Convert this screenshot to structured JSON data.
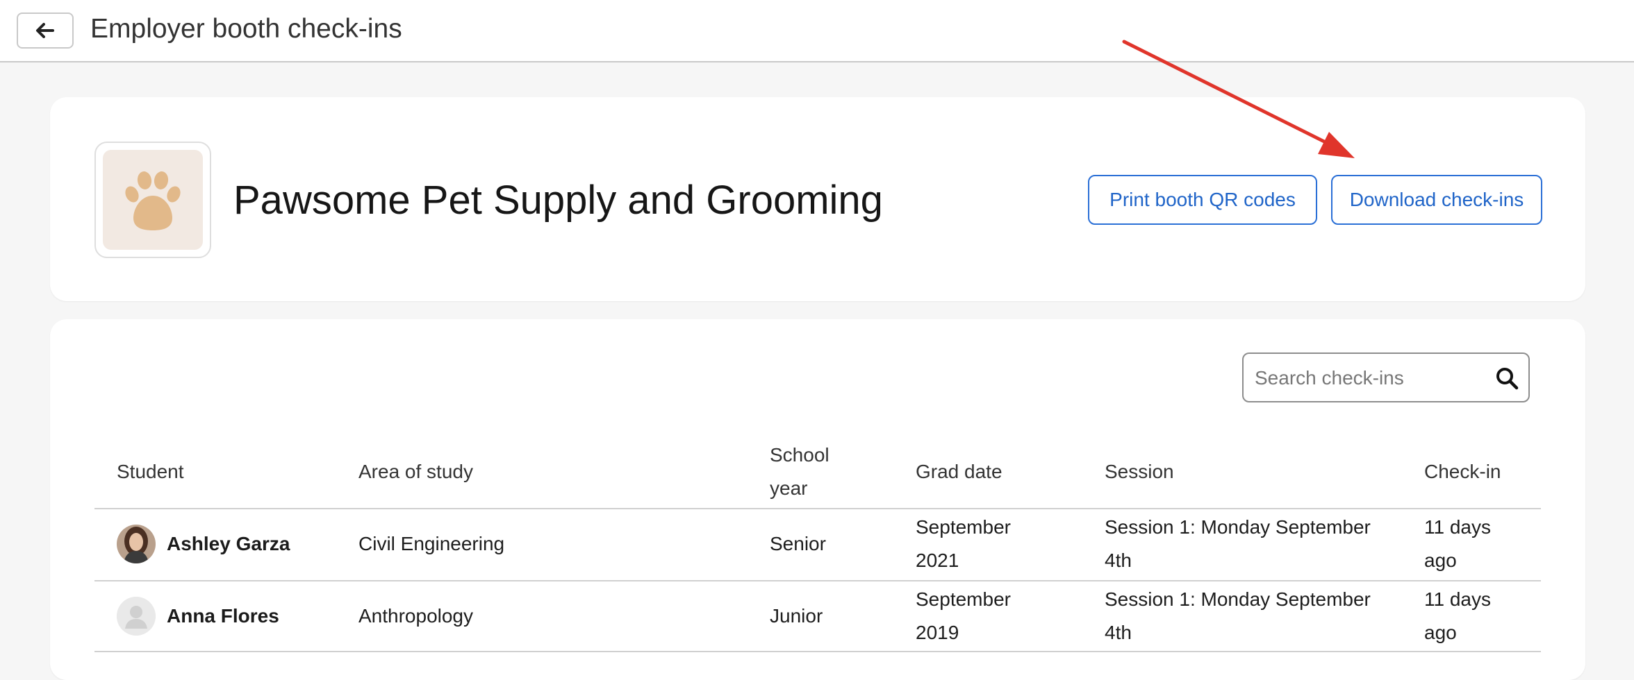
{
  "topbar": {
    "title": "Employer booth check-ins",
    "back_icon": "arrow-left-icon"
  },
  "employer": {
    "name": "Pawsome Pet Supply and Grooming",
    "logo_icon": "paw-icon",
    "print_label": "Print booth QR codes",
    "download_label": "Download check-ins"
  },
  "search": {
    "placeholder": "Search check-ins",
    "icon": "search-icon"
  },
  "table": {
    "headers": {
      "student": "Student",
      "area": "Area of study",
      "year_line1": "School",
      "year_line2": "year",
      "grad": "Grad date",
      "session": "Session",
      "checkin": "Check-in"
    },
    "rows": [
      {
        "name": "Ashley Garza",
        "area": "Civil Engineering",
        "year": "Senior",
        "grad_line1": "September",
        "grad_line2": "2021",
        "session_line1": "Session 1: Monday September",
        "session_line2": "4th",
        "checkin_line1": "11 days",
        "checkin_line2": "ago"
      },
      {
        "name": "Anna Flores",
        "area": "Anthropology",
        "year": "Junior",
        "grad_line1": "September",
        "grad_line2": "2019",
        "session_line1": "Session 1: Monday September",
        "session_line2": "4th",
        "checkin_line1": "11 days",
        "checkin_line2": "ago"
      }
    ]
  },
  "colors": {
    "accent": "#2a6fd6",
    "annotation_arrow": "#e0352b",
    "logo_bg": "#f2e9e2",
    "paw": "#e2b98a"
  }
}
